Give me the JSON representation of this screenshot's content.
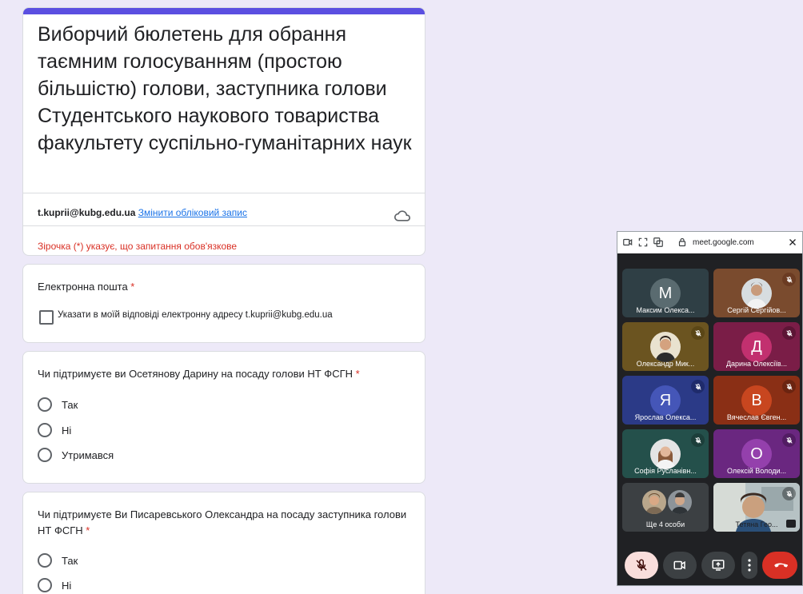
{
  "form": {
    "title": "Виборчий бюлетень для обрання таємним голосуванням (простою більшістю) голови, заступника голови Студентського наукового товариства факультету суспільно-гуманітарних наук",
    "account_email": "t.kuprii@kubg.edu.ua",
    "switch_account_label": "Змінити обліковий запис",
    "required_note": "Зірочка (*) указує, що запитання обов'язкове",
    "accent_color": "#5b4fe1",
    "email_question": {
      "title": "Електронна пошта",
      "required_mark": "*",
      "checkbox_label": "Указати в моїй відповіді електронну адресу t.kuprii@kubg.edu.ua"
    },
    "question1": {
      "title": "Чи підтримуєте ви Осетянову Дарину на посаду голови НТ ФСГН",
      "required_mark": "*",
      "options": [
        "Так",
        "Ні",
        "Утримався"
      ]
    },
    "question2": {
      "title": "Чи підтримуєте Ви Писаревського Олександра на посаду заступника голови НТ ФСГН",
      "required_mark": "*",
      "options": [
        "Так",
        "Ні"
      ]
    }
  },
  "meet": {
    "url": "meet.google.com",
    "participants": [
      {
        "name": "Максим Олекса...",
        "initial": "М",
        "color": "#4f6268",
        "muted": false
      },
      {
        "name": "Сергій Сергійов...",
        "initial": "",
        "color": "#7a4b2e",
        "muted": true
      },
      {
        "name": "Олександр Мик...",
        "initial": "",
        "color": "#6b5420",
        "muted": true
      },
      {
        "name": "Дарина Олексіїв...",
        "initial": "Д",
        "color": "#b52e6a",
        "muted": true
      },
      {
        "name": "Ярослав Олекса...",
        "initial": "Я",
        "color": "#3f51b5",
        "muted": true
      },
      {
        "name": "Вячеслав Євген...",
        "initial": "В",
        "color": "#c1451e",
        "muted": true
      },
      {
        "name": "Софія Русланівн...",
        "initial": "",
        "color": "#2e5a55",
        "muted": true
      },
      {
        "name": "Олексій Володи...",
        "initial": "О",
        "color": "#8e3aa6",
        "muted": true
      },
      {
        "name": "Ще 4 особи",
        "initial": "",
        "color": "#3c4043",
        "muted": false
      },
      {
        "name": "Тетяна Гео...",
        "initial": "",
        "color": "#8a9aa0",
        "muted": true
      }
    ],
    "end_call_color": "#d93025"
  }
}
